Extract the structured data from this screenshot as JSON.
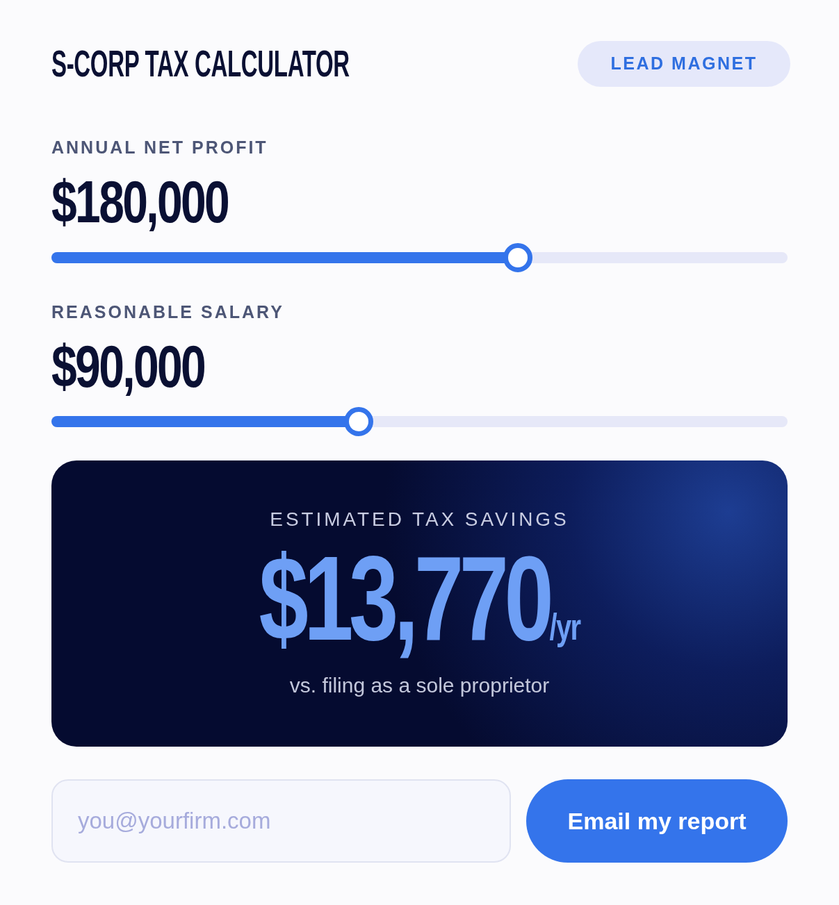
{
  "header": {
    "title": "S-CORP TAX CALCULATOR",
    "badge": "LEAD MAGNET"
  },
  "inputs": [
    {
      "label": "ANNUAL NET PROFIT",
      "value": "$180,000",
      "level": 0.634
    },
    {
      "label": "REASONABLE SALARY",
      "value": "$90,000",
      "level": 0.417
    }
  ],
  "result": {
    "label": "ESTIMATED TAX SAVINGS",
    "amount": "$13,770",
    "unit": "/yr",
    "note": "vs. filing as a sole proprietor"
  },
  "email": {
    "placeholder": "you@yourfirm.com",
    "button": "Email my report"
  }
}
